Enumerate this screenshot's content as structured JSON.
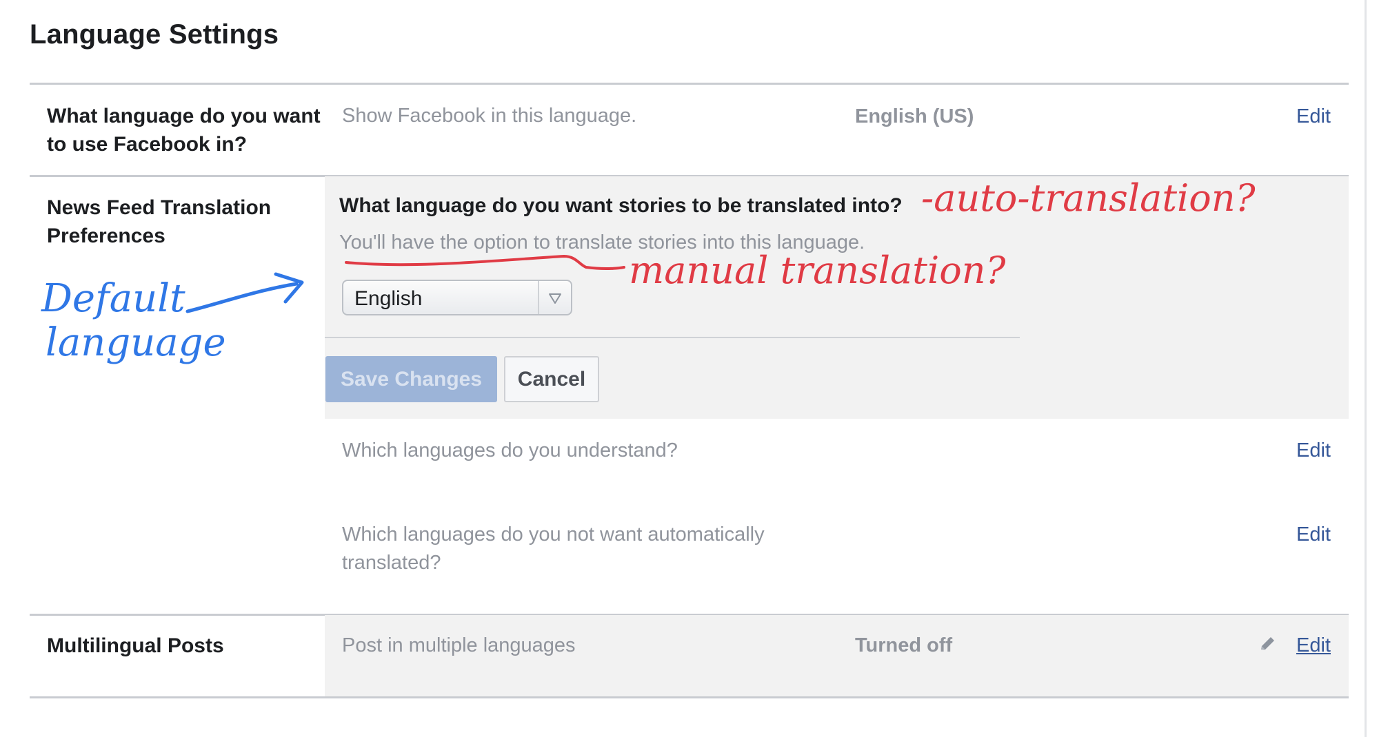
{
  "page": {
    "title": "Language Settings"
  },
  "rows": {
    "facebook_language": {
      "label": "What language do you want to use Facebook in?",
      "description": "Show Facebook in this language.",
      "value": "English (US)",
      "action": "Edit"
    },
    "news_feed_translation": {
      "label": "News Feed Translation Preferences",
      "question": "What language do you want stories to be translated into?",
      "hint": "You'll have the option to translate stories into this language.",
      "select_value": "English",
      "save_label": "Save Changes",
      "cancel_label": "Cancel",
      "understand": {
        "label": "Which languages do you understand?",
        "action": "Edit"
      },
      "no_auto_translate": {
        "label": "Which languages do you not want automatically translated?",
        "action": "Edit"
      }
    },
    "multilingual_posts": {
      "label": "Multilingual Posts",
      "description": "Post in multiple languages",
      "value": "Turned off",
      "action": "Edit"
    }
  },
  "annotations": {
    "auto_translation": "-auto-translation?",
    "manual_translation": "manual translation?",
    "default_language": "Default language"
  },
  "colors": {
    "link": "#365899",
    "muted_text": "#90949c",
    "panel": "#f2f2f2",
    "save_disabled": "#9cb4d8",
    "annotation_red": "#e03b45",
    "annotation_blue": "#2f77e6"
  }
}
